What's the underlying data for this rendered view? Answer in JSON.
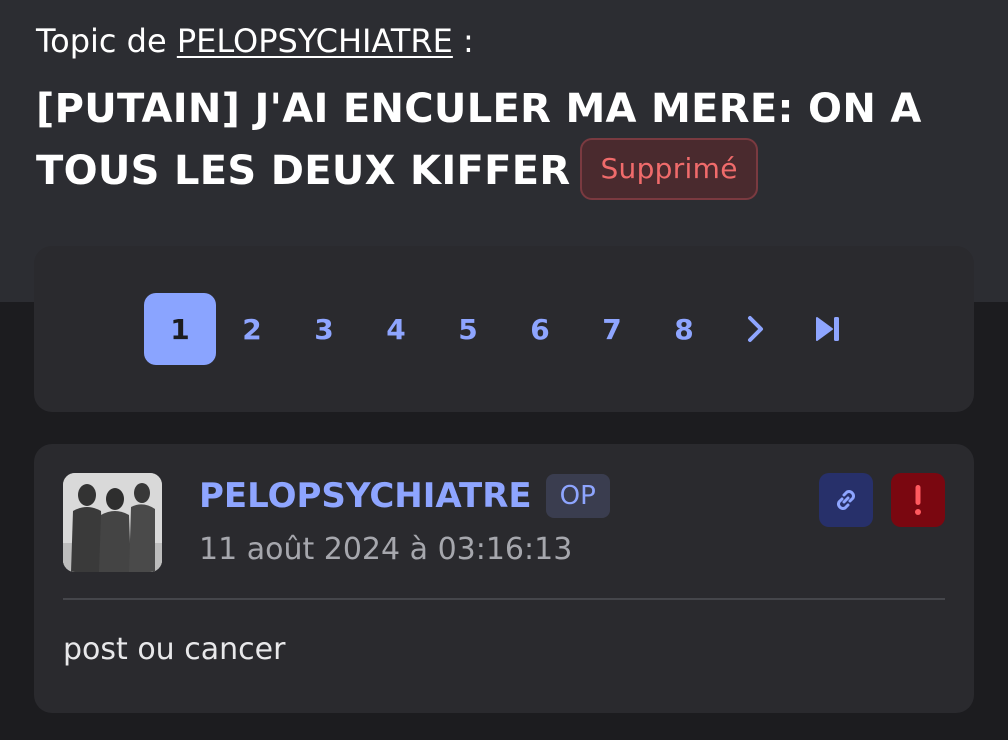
{
  "header": {
    "topic_prefix": "Topic de ",
    "topic_author": "PELOPSYCHIATRE",
    "topic_suffix": " :",
    "title": "[PUTAIN] J'AI ENCULER MA MERE: ON A TOUS LES DEUX KIFFER",
    "status_badge": "Supprimé"
  },
  "pagination": {
    "pages": [
      "1",
      "2",
      "3",
      "4",
      "5",
      "6",
      "7",
      "8"
    ],
    "current": "1",
    "next_icon": "chevron-right-icon",
    "last_icon": "skip-to-end-icon"
  },
  "post": {
    "author": "PELOPSYCHIATRE",
    "op_label": "OP",
    "date": "11 août 2024 à 03:16:13",
    "content": "post ou cancer",
    "link_icon": "link-icon",
    "report_icon": "exclamation-icon"
  },
  "colors": {
    "accent": "#8ea5ff",
    "danger": "#f06b6b",
    "background": "#1c1c1f",
    "card": "#2a2a2e"
  }
}
